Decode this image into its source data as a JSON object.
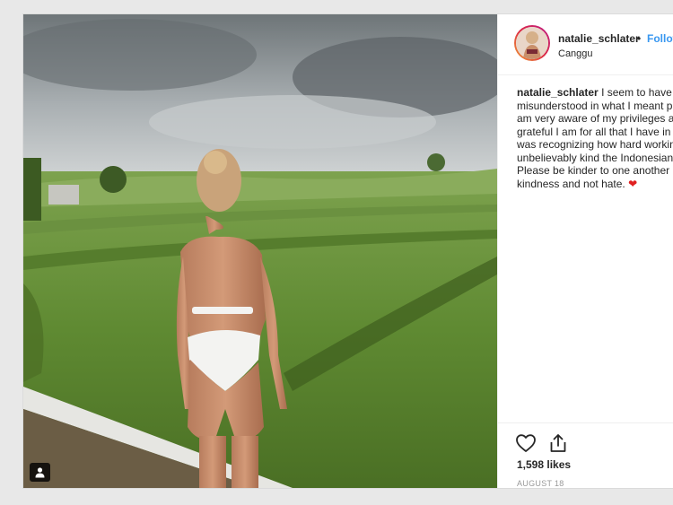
{
  "post": {
    "username": "natalie_schlater",
    "separator": "•",
    "follow_label": "Follow",
    "location": "Canggu",
    "caption": {
      "username": "natalie_schlater",
      "lines": [
        "I seem to have b",
        "misunderstood in what I meant p",
        "am very aware of my privileges a",
        "grateful I am for all that I have in",
        "was recognizing how hard workin",
        "unbelievably kind the Indonesian",
        "Please be kinder to one another",
        "kindness and not hate."
      ],
      "emoji": "❤"
    },
    "likes": "1,598 likes",
    "date": "AUGUST 18"
  },
  "icons": {
    "like": "heart-outline-icon",
    "share": "share-upload-icon",
    "tag": "user-tag-icon"
  },
  "colors": {
    "follow_link": "#3897f0",
    "emoji_heart": "#e02020",
    "date_text": "#999999"
  }
}
